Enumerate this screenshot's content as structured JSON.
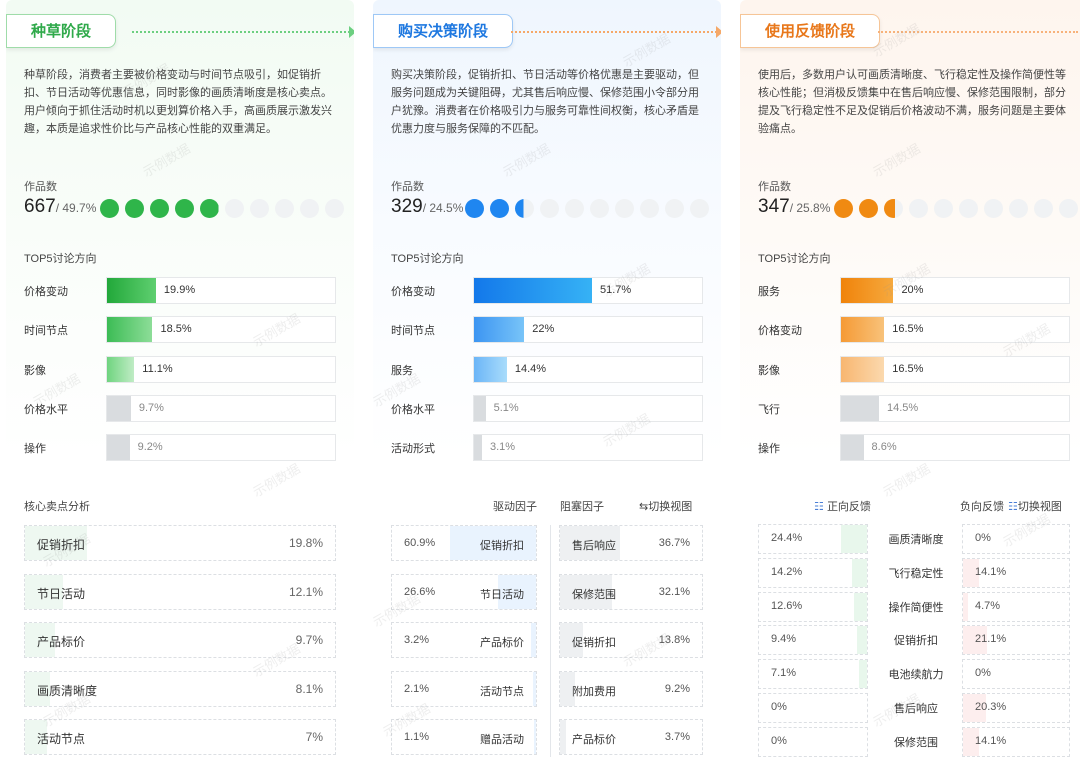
{
  "watermark": "示例数据",
  "panels": {
    "seed": {
      "stage": "种草阶段",
      "description": "种草阶段，消费者主要被价格变动与时间节点吸引，如促销折扣、节日活动等优惠信息，同时影像的画质清晰度是核心卖点。用户倾向于抓住活动时机以更划算价格入手，高画质展示激发兴趣，本质是追求性价比与产品核心性能的双重满足。",
      "works_label": "作品数",
      "works_count": "667",
      "works_pct": "/ 49.7%",
      "works_share": 0.497,
      "top5_title": "TOP5讨论方向",
      "top5": [
        {
          "label": "价格变动",
          "value": "19.9%"
        },
        {
          "label": "时间节点",
          "value": "18.5%"
        },
        {
          "label": "影像",
          "value": "11.1%"
        },
        {
          "label": "价格水平",
          "value": "9.7%"
        },
        {
          "label": "操作",
          "value": "9.2%"
        }
      ],
      "selling_title": "核心卖点分析",
      "selling": [
        {
          "label": "促销折扣",
          "value": "19.8%"
        },
        {
          "label": "节日活动",
          "value": "12.1%"
        },
        {
          "label": "产品标价",
          "value": "9.7%"
        },
        {
          "label": "画质清晰度",
          "value": "8.1%"
        },
        {
          "label": "活动节点",
          "value": "7%"
        }
      ]
    },
    "buy": {
      "stage": "购买决策阶段",
      "description": "购买决策阶段，促销折扣、节日活动等价格优惠是主要驱动，但服务问题成为关键阻碍，尤其售后响应慢、保修范围小令部分用户犹豫。消费者在价格吸引力与服务可靠性间权衡，核心矛盾是优惠力度与服务保障的不匹配。",
      "works_label": "作品数",
      "works_count": "329",
      "works_pct": "/ 24.5%",
      "works_share": 0.245,
      "top5_title": "TOP5讨论方向",
      "top5": [
        {
          "label": "价格变动",
          "value": "51.7%"
        },
        {
          "label": "时间节点",
          "value": "22%"
        },
        {
          "label": "服务",
          "value": "14.4%"
        },
        {
          "label": "价格水平",
          "value": "5.1%"
        },
        {
          "label": "活动形式",
          "value": "3.1%"
        }
      ],
      "drive_label": "驱动因子",
      "block_label": "阻塞因子",
      "switch_label": "切换视图",
      "drive": [
        {
          "label": "促销折扣",
          "value": "60.9%"
        },
        {
          "label": "节日活动",
          "value": "26.6%"
        },
        {
          "label": "产品标价",
          "value": "3.2%"
        },
        {
          "label": "活动节点",
          "value": "2.1%"
        },
        {
          "label": "赠品活动",
          "value": "1.1%"
        }
      ],
      "block": [
        {
          "label": "售后响应",
          "value": "36.7%"
        },
        {
          "label": "保修范围",
          "value": "32.1%"
        },
        {
          "label": "促销折扣",
          "value": "13.8%"
        },
        {
          "label": "附加费用",
          "value": "9.2%"
        },
        {
          "label": "产品标价",
          "value": "3.7%"
        }
      ]
    },
    "use": {
      "stage": "使用反馈阶段",
      "description": "使用后，多数用户认可画质清晰度、飞行稳定性及操作简便性等核心性能；但消极反馈集中在售后响应慢、保修范围限制，部分提及飞行稳定性不足及促销后价格波动不满，服务问题是主要体验痛点。",
      "works_label": "作品数",
      "works_count": "347",
      "works_pct": "/ 25.8%",
      "works_share": 0.258,
      "top5_title": "TOP5讨论方向",
      "top5": [
        {
          "label": "服务",
          "value": "20%"
        },
        {
          "label": "价格变动",
          "value": "16.5%"
        },
        {
          "label": "影像",
          "value": "16.5%"
        },
        {
          "label": "飞行",
          "value": "14.5%"
        },
        {
          "label": "操作",
          "value": "8.6%"
        }
      ],
      "pos_label": "正向反馈",
      "neg_label": "负向反馈",
      "switch_label": "切换视图",
      "feedback": [
        {
          "label": "画质清晰度",
          "pos": "24.4%",
          "neg": "0%"
        },
        {
          "label": "飞行稳定性",
          "pos": "14.2%",
          "neg": "14.1%"
        },
        {
          "label": "操作简便性",
          "pos": "12.6%",
          "neg": "4.7%"
        },
        {
          "label": "促销折扣",
          "pos": "9.4%",
          "neg": "21.1%"
        },
        {
          "label": "电池续航力",
          "pos": "7.1%",
          "neg": "0%"
        },
        {
          "label": "售后响应",
          "pos": "0%",
          "neg": "20.3%"
        },
        {
          "label": "保修范围",
          "pos": "0%",
          "neg": "14.1%"
        }
      ]
    }
  },
  "colors": {
    "green": "#2fb54a",
    "blue": "#1f86f0",
    "orange": "#f08a12",
    "grey_bar": "#d9dcdf"
  }
}
